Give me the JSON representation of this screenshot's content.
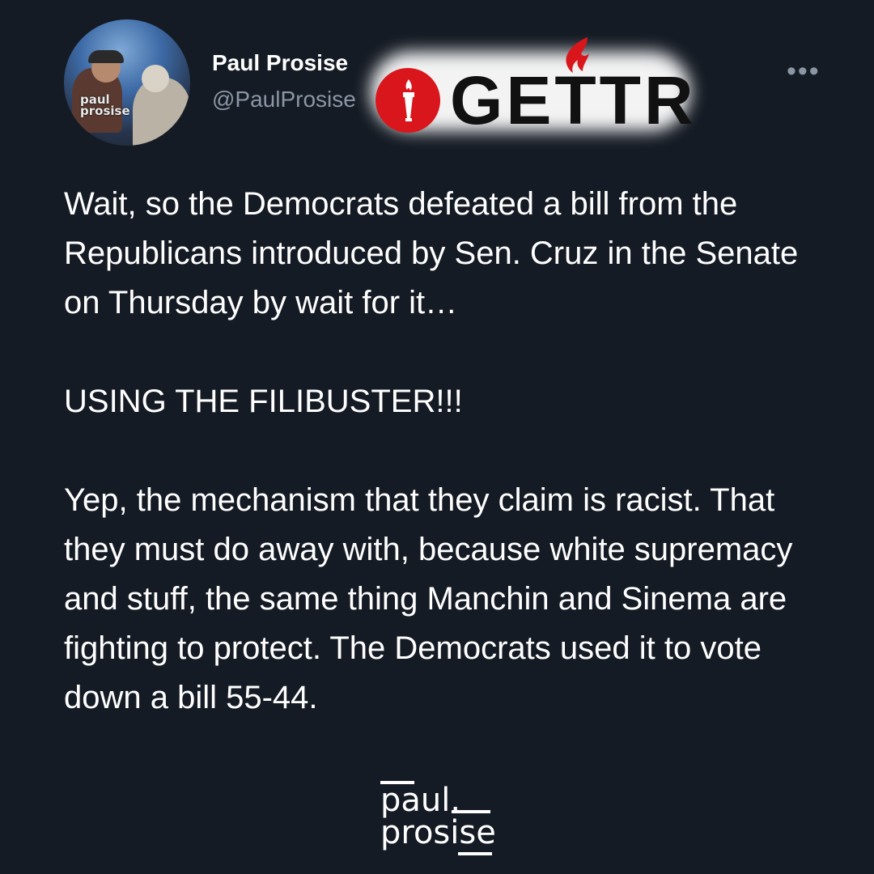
{
  "author": {
    "name": "Paul Prosise",
    "handle": "@PaulProsise",
    "avatar_label": "paul\nprosise"
  },
  "menu": {
    "icon": "more-horizontal-icon",
    "glyph": "•••"
  },
  "overlay_logo": {
    "word": "GETTR",
    "brand_color": "#d8161c"
  },
  "post": {
    "paragraphs": [
      "Wait, so the Democrats defeated a bill from the Republicans introduced by Sen. Cruz in the Senate on Thursday by wait for it…",
      "USING THE FILIBUSTER!!!",
      "Yep, the mechanism that they claim is racist. That they must do away with, because white supremacy and stuff, the same thing Manchin and Sinema are fighting to protect. The Democrats used it to vote down a bill 55-44."
    ]
  },
  "watermark": {
    "line1": "paul.",
    "line2": "prosise"
  },
  "colors": {
    "background": "#151b24",
    "text": "#ffffff",
    "muted": "#8b96a4"
  }
}
